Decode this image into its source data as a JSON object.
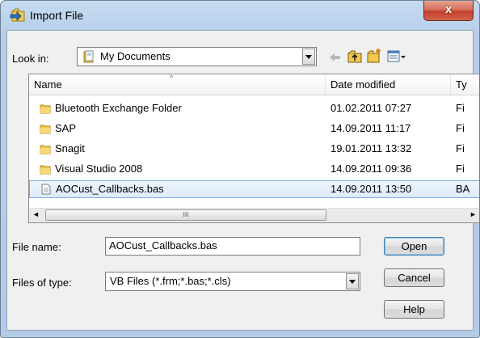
{
  "window": {
    "title": "Import File",
    "close_label": "x"
  },
  "toolbar": {
    "look_in_label": "Look in:",
    "look_in_value": "My Documents"
  },
  "columns": [
    {
      "label": "Name"
    },
    {
      "label": "Date modified"
    },
    {
      "label": "Ty"
    }
  ],
  "files": [
    {
      "name": "Bluetooth Exchange Folder",
      "date": "01.02.2011 07:27",
      "type": "Fi",
      "icon": "folder-icon"
    },
    {
      "name": "SAP",
      "date": "14.09.2011 11:17",
      "type": "Fi",
      "icon": "folder-icon"
    },
    {
      "name": "Snagit",
      "date": "19.01.2011 13:32",
      "type": "Fi",
      "icon": "folder-icon"
    },
    {
      "name": "Visual Studio 2008",
      "date": "14.09.2011 09:36",
      "type": "Fi",
      "icon": "folder-icon"
    },
    {
      "name": "AOCust_Callbacks.bas",
      "date": "14.09.2011 13:50",
      "type": "BA",
      "icon": "file-icon",
      "selected": true
    }
  ],
  "form": {
    "file_name_label": "File name:",
    "file_name_value": "AOCust_Callbacks.bas",
    "file_type_label": "Files of type:",
    "file_type_value": "VB Files (*.frm;*.bas;*.cls)"
  },
  "buttons": {
    "open": "Open",
    "cancel": "Cancel",
    "help": "Help"
  },
  "scroll": {
    "left": "◄",
    "right": "►",
    "grip": "III"
  },
  "colors": {
    "selection": "#dcebfc",
    "title_bar": "#c6dbf1",
    "close": "#c2412b"
  }
}
